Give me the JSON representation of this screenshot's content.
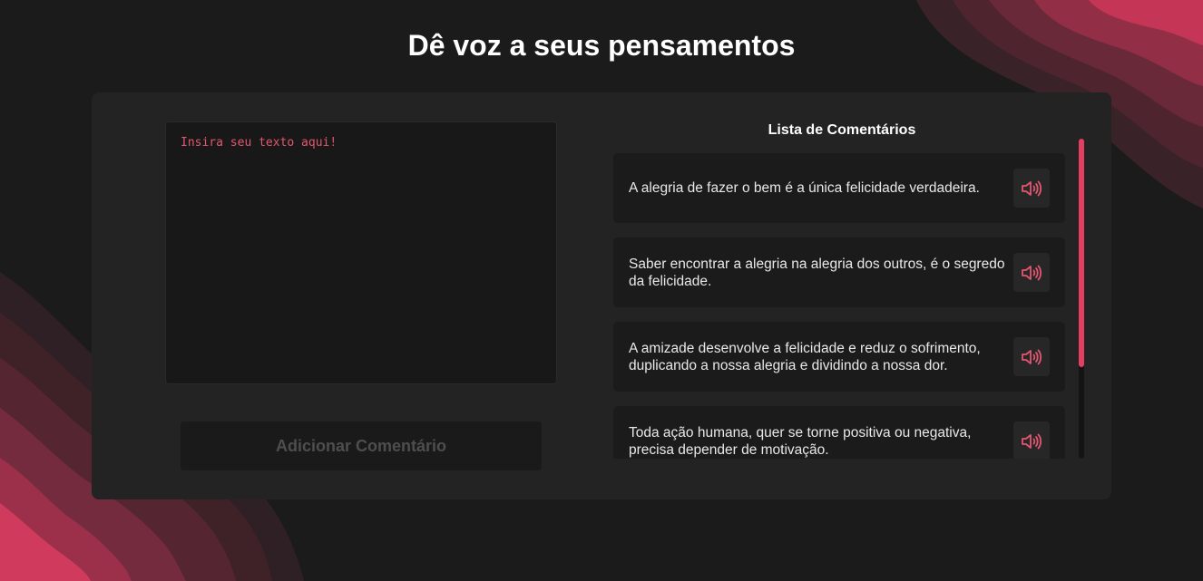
{
  "page": {
    "title": "Dê voz a seus pensamentos"
  },
  "editor": {
    "placeholder": "Insira seu texto aqui!",
    "add_button_label": "Adicionar Comentário"
  },
  "comments": {
    "title": "Lista de Comentários",
    "items": [
      {
        "text": "A alegria de fazer o bem é a única felicidade verdadeira."
      },
      {
        "text": "Saber encontrar a alegria na alegria dos outros, é o segredo da felicidade."
      },
      {
        "text": "A amizade desenvolve a felicidade e reduz o sofrimento, duplicando a nossa alegria e dividindo a nossa dor."
      },
      {
        "text": "Toda ação humana, quer se torne positiva ou negativa, precisa depender de motivação."
      }
    ],
    "speak_icon": "speaker-icon"
  },
  "colors": {
    "accent": "#e4566f",
    "background": "#1b1b1b",
    "panel": "#232323"
  }
}
